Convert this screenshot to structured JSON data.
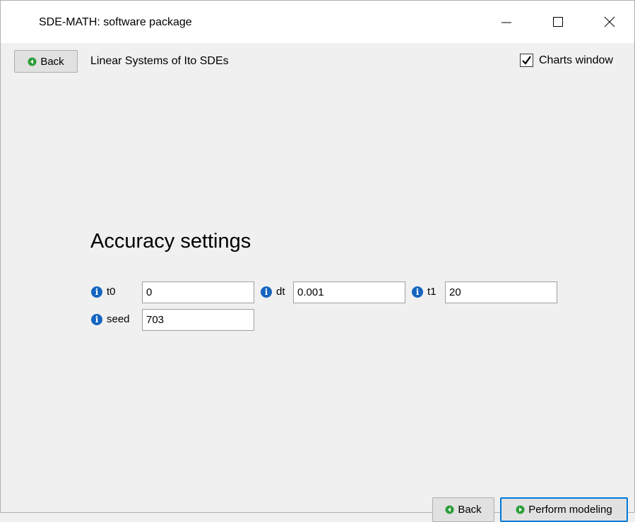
{
  "window": {
    "title": "SDE-MATH: software package",
    "controls": {
      "minimize_icon": "minimize-icon",
      "maximize_icon": "maximize-icon",
      "close_icon": "close-icon"
    }
  },
  "toolbar": {
    "back_label": "Back",
    "subtitle": "Linear Systems of Ito SDEs",
    "charts_window_label": "Charts window",
    "charts_window_checked": true
  },
  "main": {
    "heading": "Accuracy settings",
    "fields": [
      {
        "label": "t0",
        "value": "0"
      },
      {
        "label": "dt",
        "value": "0.001"
      },
      {
        "label": "t1",
        "value": "20"
      },
      {
        "label": "seed",
        "value": "703"
      }
    ]
  },
  "footer": {
    "back_label": "Back",
    "perform_label": "Perform modeling"
  },
  "colors": {
    "accent": "#0078d7",
    "info_icon": "#1565c0",
    "green_icon": "#2e9e3a"
  }
}
